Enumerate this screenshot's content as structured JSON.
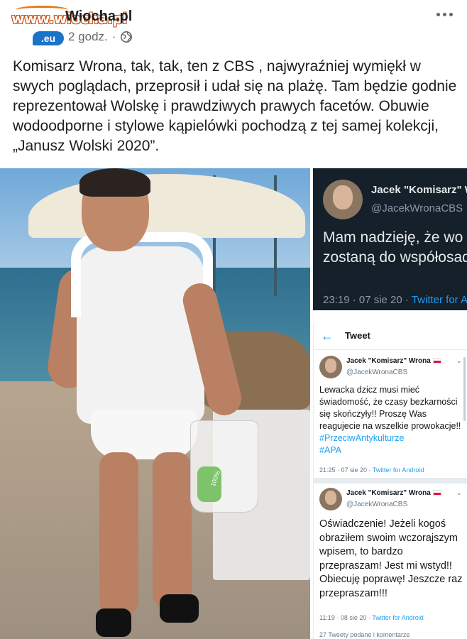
{
  "header": {
    "logo_text": "www.wiocha.pl",
    "logo_suffix": ".eu",
    "author_name": "Wiocha.pl",
    "timestamp": "2 godz.",
    "separator": "·",
    "audience_icon": "globe-icon",
    "more_icon": "more-options-icon"
  },
  "post": {
    "text": "Komisarz Wrona, tak, tak, ten z CBS , najwyraźniej wymiękł w swych poglądach, przeprosił i udał się na plażę. Tam będzie godnie reprezentował Wolskę i prawdziwych prawych facetów. Obuwie wodoodporne i stylowe kąpielówki pochodzą  z tej samej kolekcji, „Janusz Wolski 2020”."
  },
  "photo": {
    "bag_label": "100%"
  },
  "tweet_dark": {
    "name": "Jacek \"Komisarz\" W",
    "handle": "@JacekWronaCBS",
    "text": "Mam nadzieję, że wo \"Margot\" zostaną do współosadzonych!",
    "time": "23:19 · 07 sie 20 ·",
    "source": "Twitter for A"
  },
  "tweet_panel": {
    "back_icon": "arrow-left-icon",
    "title": "Tweet",
    "tweets": [
      {
        "name": "Jacek \"Komisarz\" Wrona",
        "flag_icon": "poland-flag-icon",
        "handle": "@JacekWronaCBS",
        "text": "Lewacka dzicz musi mieć świadomość, że czasy bezkarności się skończyły!! Proszę Was reagujecie na wszelkie prowokacje!!",
        "hashtags": [
          "#PrzeciwAntykulturze",
          "#APA"
        ],
        "time": "21:25 · 07 sie 20 ·",
        "source": "Twitter for Android"
      },
      {
        "name": "Jacek \"Komisarz\" Wrona",
        "flag_icon": "poland-flag-icon",
        "handle": "@JacekWronaCBS",
        "text": "Oświadczenie! Jeżeli kogoś obraziłem swoim wczorajszym wpisem, to bardzo przepraszam! Jest mi wstyd!! Obiecuję poprawę! Jeszcze raz przepraszam!!!",
        "hashtags": [],
        "time": "11:19 · 08 sie 20 ·",
        "source": "Twitter for Android"
      }
    ],
    "footer": "27 Tweety podane i komentarze"
  },
  "colors": {
    "link_blue": "#1da1f2",
    "dark_bg": "#15202b",
    "logo_orange": "#e67a1a",
    "logo_blue": "#1a73c9"
  }
}
